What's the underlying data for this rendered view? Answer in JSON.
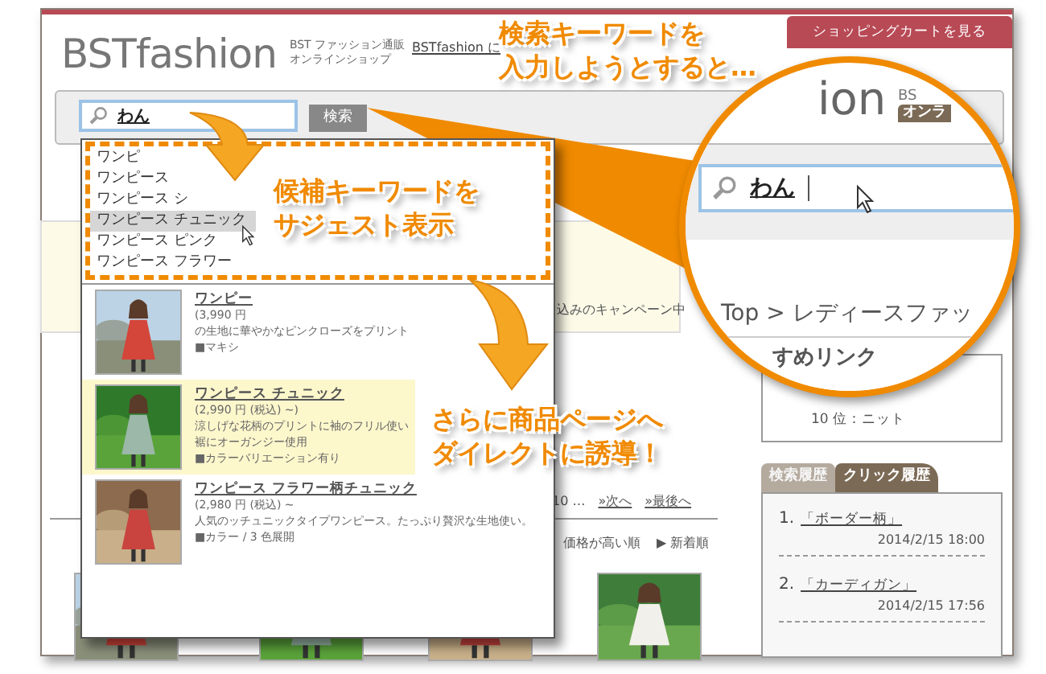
{
  "header": {
    "logo": "BSTfashion",
    "tagline": [
      "BST ファッション通販",
      "オンラインショップ"
    ],
    "link": "BSTfashion に",
    "cart_button": "ショッピングカートを見る"
  },
  "search": {
    "value": "わん",
    "button": "検索"
  },
  "suggestions": [
    {
      "label": "ワンピ",
      "selected": false
    },
    {
      "label": "ワンピース",
      "selected": false
    },
    {
      "label": "ワンピース シ",
      "selected": false
    },
    {
      "label": "ワンピース チュニック",
      "selected": true
    },
    {
      "label": "ワンピース ピンク",
      "selected": false
    },
    {
      "label": "ワンピース フラワー",
      "selected": false
    }
  ],
  "products": [
    {
      "title": "ワンピー",
      "price": "(3,990 円",
      "lines": [
        "の生地に華やかなピンクローズをプリント",
        "■マキシ"
      ],
      "selected": false,
      "kind": "picture"
    },
    {
      "title": "ワンピース チュニック",
      "price": "(2,990 円 (税込) ~)",
      "lines": [
        "涼しげな花柄のプリントに袖のフリル使い",
        "裾にオーガンジー使用",
        "■カラーバリエーション有り"
      ],
      "selected": true,
      "kind": "picture"
    },
    {
      "title": "ワンピース フラワー柄チュニック",
      "price": "(2,980 円 (税込) ~",
      "lines": [
        "人気のッチュニックタイプワンピース。たっぷり贅沢な生地使い。",
        "■カラー / 3 色展開"
      ],
      "selected": false,
      "kind": "picture"
    }
  ],
  "page_behind": {
    "campaign": "込みのキャンペーン中",
    "pager": [
      "10 …",
      "»次へ",
      "»最後へ"
    ],
    "sort": [
      "価格が高い順",
      "▶ 新着順"
    ]
  },
  "magnifier": {
    "logo": "ion",
    "tagline": [
      "BS",
      "オンラ"
    ],
    "search_value": "わん",
    "breadcrumb": "Top > レディースファッ",
    "heading": "すめリンク"
  },
  "ranking": {
    "items": [
      "10 位：ニット"
    ]
  },
  "history": {
    "tabs": [
      {
        "label": "検索履歴",
        "selected": false
      },
      {
        "label": "クリック履歴",
        "selected": true
      }
    ],
    "items": [
      {
        "number": "1.",
        "term": "「ボーダー柄」",
        "time": "2014/2/15 18:00"
      },
      {
        "number": "2.",
        "term": "「カーディガン」",
        "time": "2014/2/15 17:56"
      }
    ]
  },
  "callouts": [
    {
      "lines": [
        "検索キーワードを",
        "入力しようとすると…"
      ]
    },
    {
      "lines": [
        "候補キーワードを",
        "サジェスト表示"
      ]
    },
    {
      "lines": [
        "さらに商品ページへ",
        "ダイレクトに誘導！"
      ]
    }
  ]
}
